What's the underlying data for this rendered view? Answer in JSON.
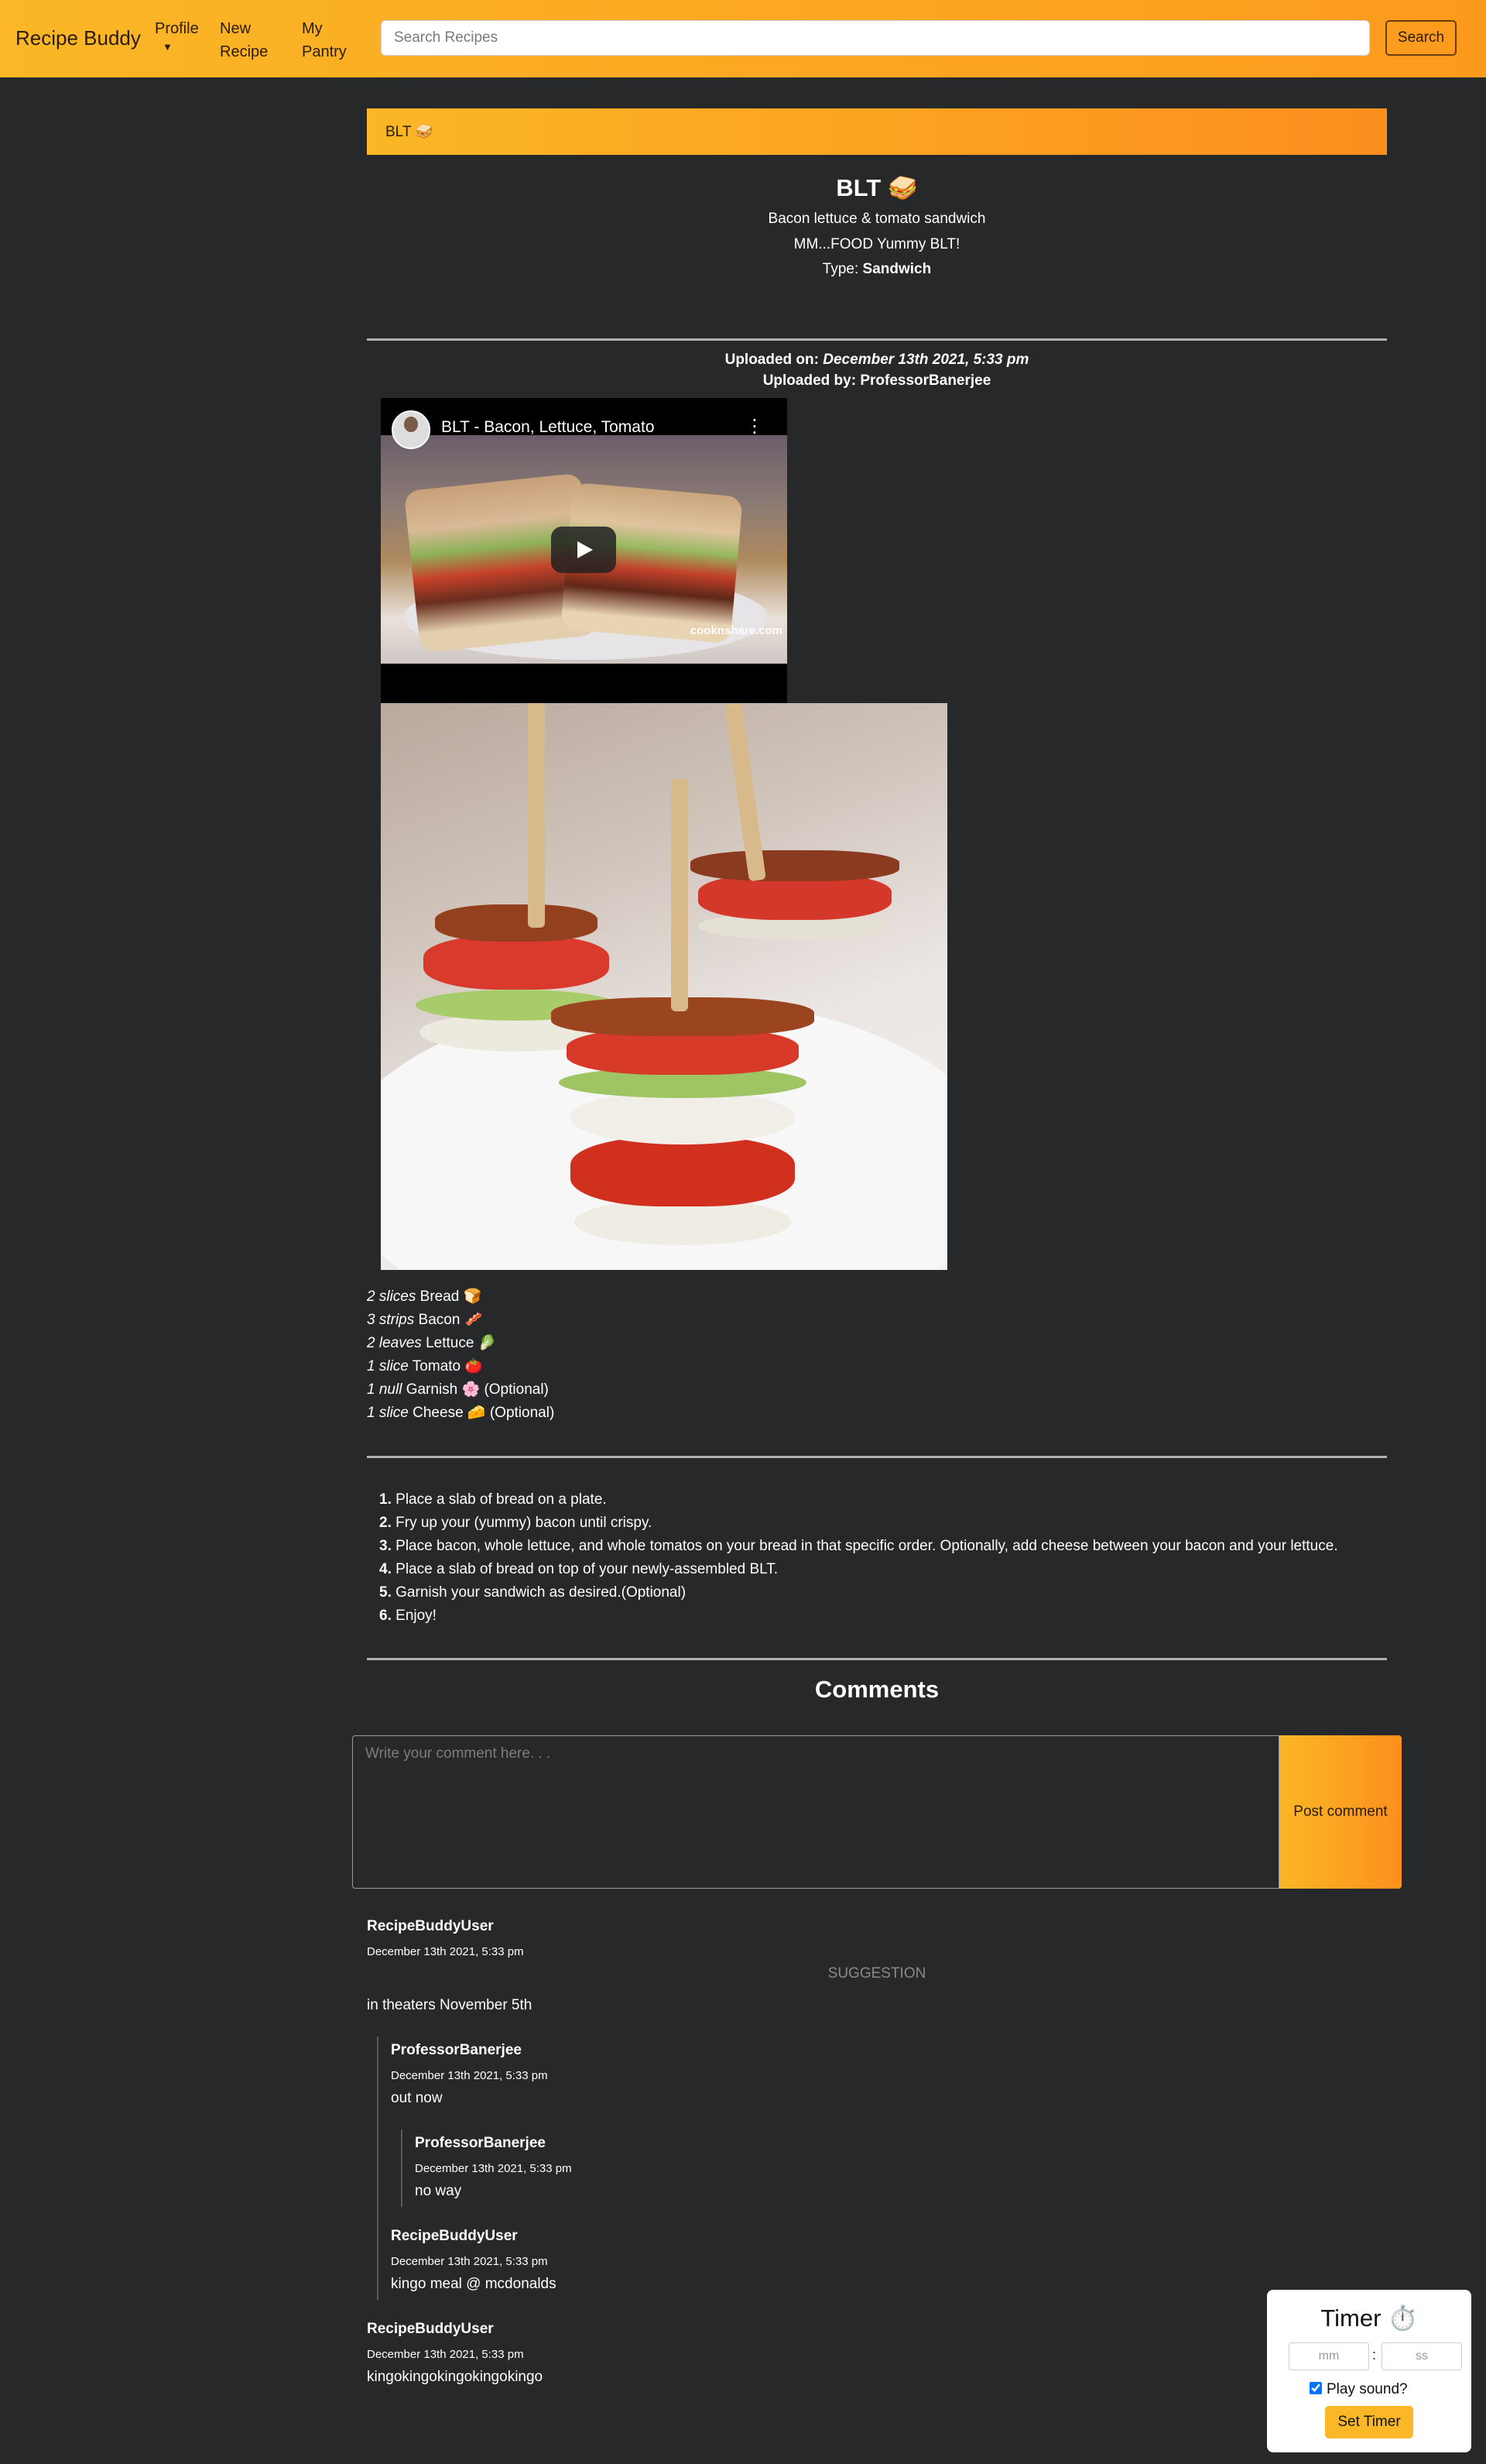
{
  "nav": {
    "brand": "Recipe Buddy",
    "profile": "Profile",
    "new_recipe_line1": "New",
    "new_recipe_line2": "Recipe",
    "pantry_line1": "My",
    "pantry_line2": "Pantry",
    "search_placeholder": "Search Recipes",
    "search_button": "Search"
  },
  "recipe": {
    "crumb": "BLT 🥪",
    "title": "BLT 🥪",
    "description": "Bacon lettuce & tomato sandwich",
    "tagline": "MM...FOOD Yummy BLT!",
    "type_label": "Type:",
    "type_value": "Sandwich",
    "uploaded_on_label": "Uploaded on:",
    "uploaded_on_value": "December 13th 2021, 5:33 pm",
    "uploaded_by_label": "Uploaded by:",
    "uploaded_by_value": "ProfessorBanerjee",
    "video_title": "BLT - Bacon, Lettuce, Tomato",
    "video_watermark": "cooknshare.com"
  },
  "ingredients": [
    {
      "qty": "2 slices",
      "name": "Bread 🍞",
      "optional": ""
    },
    {
      "qty": "3 strips",
      "name": "Bacon 🥓",
      "optional": ""
    },
    {
      "qty": "2 leaves",
      "name": "Lettuce 🥬",
      "optional": ""
    },
    {
      "qty": "1 slice",
      "name": "Tomato 🍅",
      "optional": ""
    },
    {
      "qty": "1 null",
      "name": "Garnish 🌸",
      "optional": "(Optional)"
    },
    {
      "qty": "1 slice",
      "name": "Cheese 🧀",
      "optional": "(Optional)"
    }
  ],
  "directions": [
    {
      "num": "1.",
      "text": "Place a slab of bread on a plate."
    },
    {
      "num": "2.",
      "text": "Fry up your (yummy) bacon until crispy."
    },
    {
      "num": "3.",
      "text": "Place bacon, whole lettuce, and whole tomatos on your bread in that specific order. Optionally, add cheese between your bacon and your lettuce."
    },
    {
      "num": "4.",
      "text": "Place a slab of bread on top of your newly-assembled BLT."
    },
    {
      "num": "5.",
      "text": "Garnish your sandwich as desired.(Optional)"
    },
    {
      "num": "6.",
      "text": "Enjoy!"
    }
  ],
  "comments": {
    "heading": "Comments",
    "placeholder": "Write your comment here. . .",
    "post_button": "Post comment",
    "items": [
      {
        "author": "RecipeBuddyUser",
        "date": "December 13th 2021, 5:33 pm",
        "tag": "SUGGESTION",
        "text": "in theaters November 5th"
      },
      {
        "author": "ProfessorBanerjee",
        "date": "December 13th 2021, 5:33 pm",
        "text": "out now"
      },
      {
        "author": "ProfessorBanerjee",
        "date": "December 13th 2021, 5:33 pm",
        "text": "no way"
      },
      {
        "author": "RecipeBuddyUser",
        "date": "December 13th 2021, 5:33 pm",
        "text": "kingo meal @ mcdonalds"
      },
      {
        "author": "RecipeBuddyUser",
        "date": "December 13th 2021, 5:33 pm",
        "text": "kingokingokingokingokingo"
      }
    ]
  },
  "timer": {
    "title": "Timer ⏱️",
    "mm_placeholder": "mm",
    "ss_placeholder": "ss",
    "colon": ":",
    "play_sound": "Play sound?",
    "play_sound_checked": true,
    "button": "Set Timer"
  },
  "colors": {
    "accent_start": "#fbb726",
    "accent_end": "#fc8f1e",
    "background": "#262829"
  }
}
